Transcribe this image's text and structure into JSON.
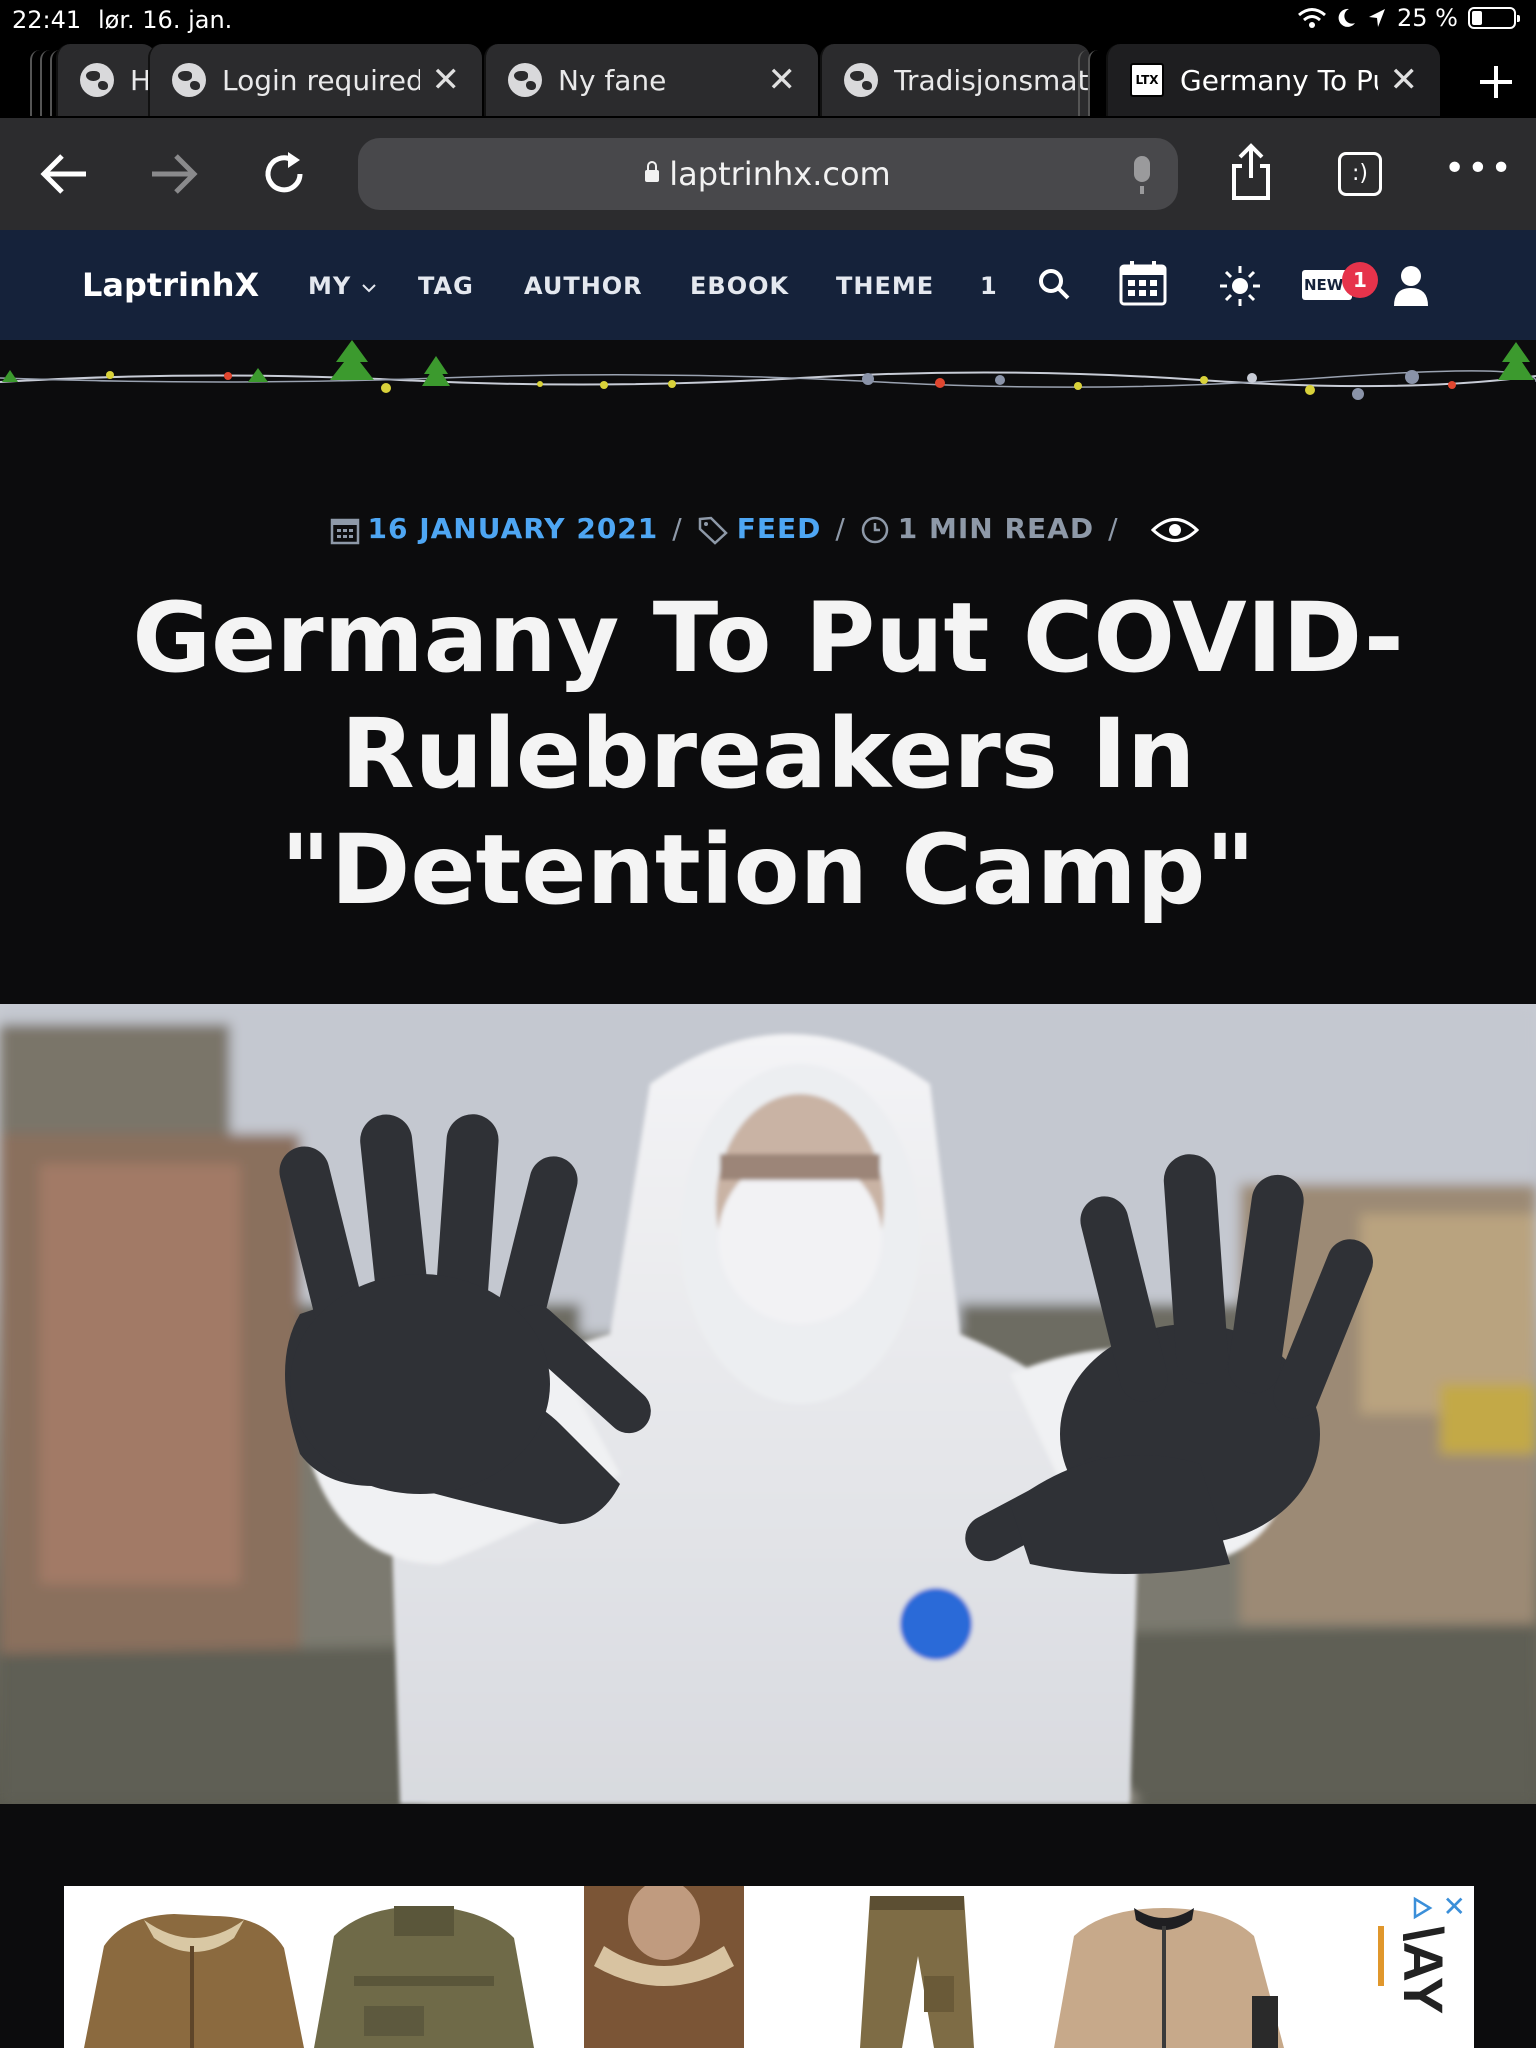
{
  "status": {
    "time": "22:41",
    "date": "lør. 16. jan.",
    "battery": "25 %",
    "battery_level": 0.25
  },
  "tabs": [
    {
      "label": "H",
      "icon": "globe-icon"
    },
    {
      "label": "Login required",
      "icon": "globe-icon"
    },
    {
      "label": "Ny fane",
      "icon": "globe-icon"
    },
    {
      "label": "Tradisjonsmat",
      "icon": "globe-icon"
    },
    {
      "label": "Germany To Put COVID-Rulebreakers In \"Detention Camp\"",
      "icon": "ltx-favicon",
      "active": true
    }
  ],
  "tab_close_glyph": "✕",
  "favicon_text": "LTX",
  "toolbar": {
    "url": "laptrinhx.com",
    "tabs_button": ":)",
    "menu": "•••"
  },
  "site": {
    "logo": "LaptrinhX",
    "nav": [
      "MY",
      "TAG",
      "AUTHOR",
      "EBOOK",
      "THEME",
      "1"
    ],
    "new_label": "NEW",
    "notification_count": "1"
  },
  "article": {
    "date": "16 JANUARY 2021",
    "category": "FEED",
    "read_time": "1 MIN READ",
    "title": "Germany To Put COVID-Rulebreakers In \"Detention Camp\""
  },
  "ad": {
    "choices_icon": "adchoices-icon",
    "close": "✕",
    "brand_fragment": "\\AY"
  },
  "colors": {
    "nav_bg": "#15223a",
    "accent_blue": "#4ea6f3",
    "badge_red": "#e6334b",
    "page_bg": "#0c0c0d"
  }
}
